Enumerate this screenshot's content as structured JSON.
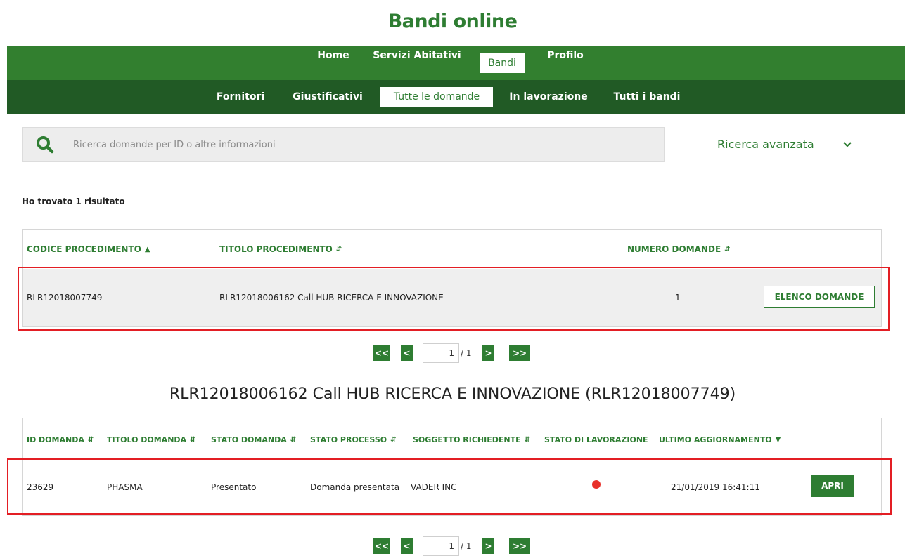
{
  "app": {
    "title": "Bandi online"
  },
  "nav": {
    "main": [
      "Home",
      "Servizi Abitativi",
      "Bandi",
      "Profilo"
    ],
    "sub": [
      "Fornitori",
      "Giustificativi",
      "Tutte le domande",
      "In lavorazione",
      "Tutti i bandi"
    ]
  },
  "search": {
    "placeholder": "Ricerca domande per ID o altre informazioni",
    "advanced_label": "Ricerca avanzata"
  },
  "results": {
    "count_text": "Ho trovato 1 risultato"
  },
  "procedures_table": {
    "headers": [
      "CODICE PROCEDIMENTO",
      "TITOLO PROCEDIMENTO",
      "NUMERO DOMANDE"
    ],
    "rows": [
      {
        "codice": "RLR12018007749",
        "titolo": "RLR12018006162 Call HUB RICERCA E INNOVAZIONE",
        "numero": "1",
        "action": "ELENCO DOMANDE"
      }
    ]
  },
  "pagination": {
    "first": "<<",
    "prev": "<",
    "current": "1",
    "total": "/ 1",
    "next": ">",
    "last": ">>"
  },
  "detail": {
    "title": "RLR12018006162 Call HUB RICERCA E INNOVAZIONE (RLR12018007749)",
    "headers": [
      "ID DOMANDA",
      "TITOLO DOMANDA",
      "STATO DOMANDA",
      "STATO PROCESSO",
      "SOGGETTO RICHIEDENTE",
      "STATO DI LAVORAZIONE",
      "ULTIMO AGGIORNAMENTO"
    ],
    "rows": [
      {
        "id": "23629",
        "titolo": "PHASMA",
        "stato_domanda": "Presentato",
        "stato_processo": "Domanda presentata",
        "soggetto": "VADER INC",
        "stato_lavorazione_color": "#e8302a",
        "ultimo_aggiornamento": "21/01/2019 16:41:11",
        "action": "APRI"
      }
    ]
  },
  "colors": {
    "primary_green": "#327f2f",
    "dark_green": "#215a25",
    "highlight_red": "#e31e24",
    "status_red": "#e8302a"
  }
}
